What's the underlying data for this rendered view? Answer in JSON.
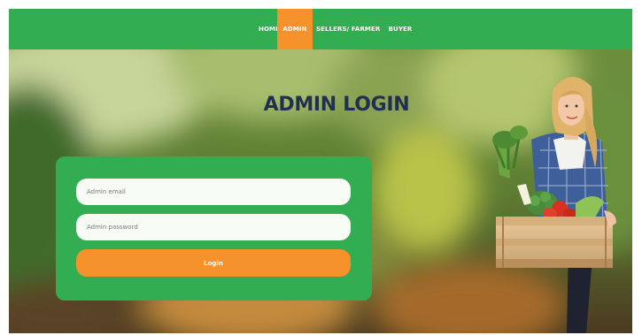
{
  "nav": {
    "items": [
      {
        "label": "HOME",
        "active": false
      },
      {
        "label": "ADMIN",
        "active": true
      },
      {
        "label": "SELLERS/ FARMER",
        "active": false
      },
      {
        "label": "BUYER",
        "active": false
      }
    ]
  },
  "login": {
    "title": "ADMIN LOGIN",
    "email_placeholder": "Admin email",
    "password_placeholder": "Admin password",
    "button_label": "Login"
  },
  "colors": {
    "brand_green": "#33ad51",
    "accent_orange": "#f6922b",
    "title_navy": "#22304f"
  }
}
